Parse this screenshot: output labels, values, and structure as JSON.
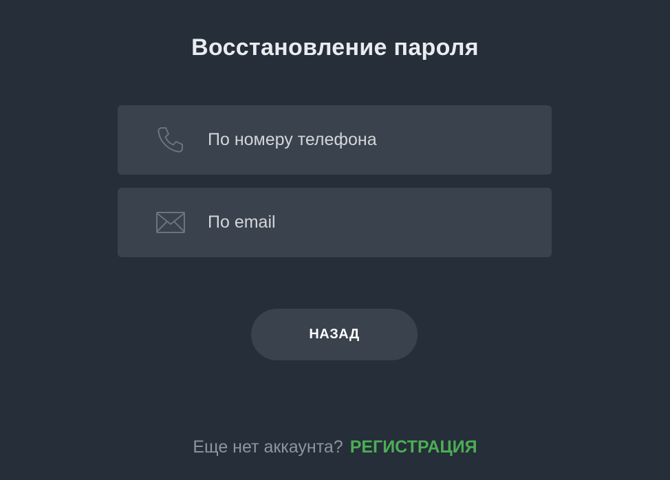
{
  "title": "Восстановление пароля",
  "options": [
    {
      "icon": "phone-icon",
      "label": "По номеру телефона"
    },
    {
      "icon": "envelope-icon",
      "label": "По email"
    }
  ],
  "back_button": {
    "label": "НАЗАД"
  },
  "footer": {
    "question": "Еще нет аккаунта?",
    "register_label": "РЕГИСТРАЦИЯ"
  },
  "colors": {
    "background": "#252e39",
    "card": "#39424d",
    "accent_green": "#4cae55",
    "title_text": "#e9ecef",
    "muted_text": "#8d95a0"
  }
}
